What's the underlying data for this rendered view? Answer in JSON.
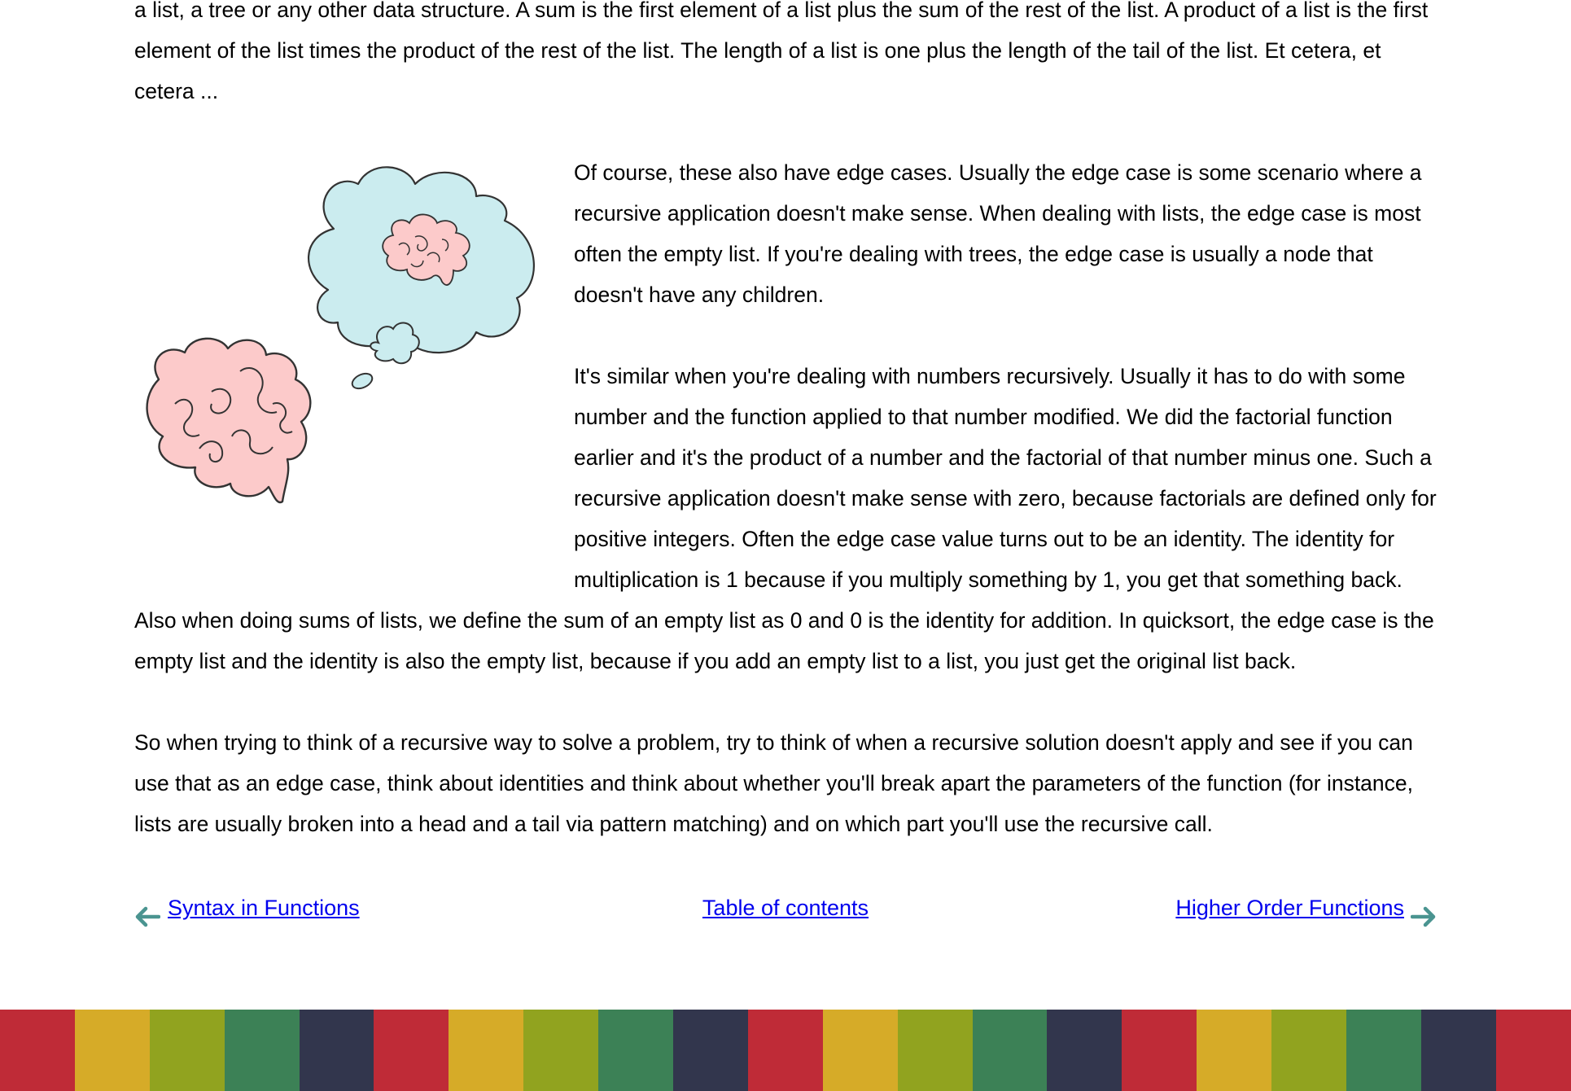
{
  "article": {
    "paragraphs": [
      "a list, a tree or any other data structure. A sum is the first element of a list plus the sum of the rest of the list. A product of a list is the first element of the list times the product of the rest of the list. The length of a list is one plus the length of the tail of the list. Et cetera, et cetera ...",
      "Of course, these also have edge cases. Usually the edge case is some scenario where a recursive application doesn't make sense. When dealing with lists, the edge case is most often the empty list. If you're dealing with trees, the edge case is usually a node that doesn't have any children.",
      "It's similar when you're dealing with numbers recursively. Usually it has to do with some number and the function applied to that number modified. We did the factorial function earlier and it's the product of a number and the factorial of that number minus one. Such a recursive application doesn't make sense with zero, because factorials are defined only for positive integers. Often the edge case value turns out to be an identity. The identity for multiplication is 1 because if you multiply something by 1, you get that something back. Also when doing sums of lists, we define the sum of an empty list as 0 and 0 is the identity for addition. In quicksort, the edge case is the empty list and the identity is also the empty list, because if you add an empty list to a list, you just get the original list back.",
      "So when trying to think of a recursive way to solve a problem, try to think of when a recursive solution doesn't apply and see if you can use that as an edge case, think about identities and think about whether you'll break apart the parameters of the function (for instance, lists are usually broken into a head and a tail via pattern matching) and on which part you'll use the recursive call."
    ],
    "illustration_icon": "brain-thinking-icon"
  },
  "navigation": {
    "prev_label": "Syntax in Functions",
    "toc_label": "Table of contents",
    "next_label": "Higher Order Functions",
    "arrow_color": "#4a9490",
    "link_color": "#0000ee"
  },
  "footer": {
    "stripe_colors": [
      "#bf2b37",
      "#d6ab28",
      "#91a31f",
      "#3c8156",
      "#32364d"
    ]
  }
}
